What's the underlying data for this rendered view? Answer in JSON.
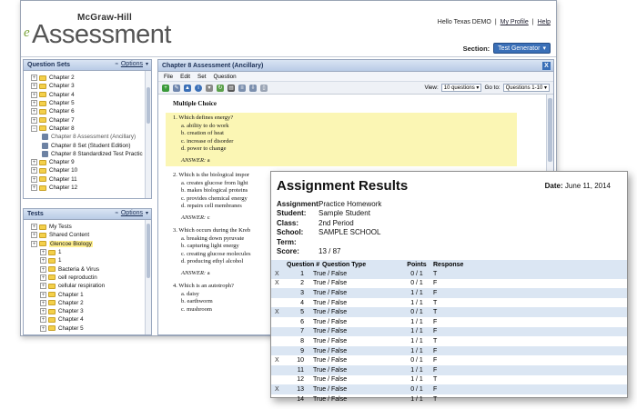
{
  "header": {
    "logo_top": "McGraw-Hill",
    "logo_e": "e",
    "logo_main": "Assessment",
    "greeting": "Hello Texas DEMO",
    "separator": "|",
    "my_profile": "My Profile",
    "help": "Help",
    "section_label": "Section:",
    "section_value": "Test Generator"
  },
  "question_sets": {
    "title": "Question Sets",
    "options": "Options",
    "items": [
      {
        "label": "Chapter 2",
        "kind": "folder"
      },
      {
        "label": "Chapter 3",
        "kind": "folder"
      },
      {
        "label": "Chapter 4",
        "kind": "folder"
      },
      {
        "label": "Chapter 5",
        "kind": "folder"
      },
      {
        "label": "Chapter 6",
        "kind": "folder"
      },
      {
        "label": "Chapter 7",
        "kind": "folder"
      },
      {
        "label": "Chapter 8",
        "kind": "folder",
        "expanded": true
      },
      {
        "label": "Chapter 8 Assessment (Ancillary)",
        "kind": "doc",
        "dim": true
      },
      {
        "label": "Chapter 8 Set (Student Edition)",
        "kind": "doc"
      },
      {
        "label": "Chapter 8 Standardized Test Practic",
        "kind": "doc"
      },
      {
        "label": "Chapter 9",
        "kind": "folder"
      },
      {
        "label": "Chapter 10",
        "kind": "folder"
      },
      {
        "label": "Chapter 11",
        "kind": "folder"
      },
      {
        "label": "Chapter 12",
        "kind": "folder"
      }
    ]
  },
  "tests": {
    "title": "Tests",
    "options": "Options",
    "items": [
      {
        "label": "My Tests",
        "kind": "folder",
        "level": 0
      },
      {
        "label": "Shared Content",
        "kind": "folder",
        "level": 0
      },
      {
        "label": "Glencoe Biology",
        "kind": "folder",
        "level": 0,
        "highlight": true
      },
      {
        "label": "1",
        "kind": "folder",
        "level": 1
      },
      {
        "label": "1",
        "kind": "folder",
        "level": 1
      },
      {
        "label": "Bacteria & Virus",
        "kind": "folder",
        "level": 1
      },
      {
        "label": "cell reproductin",
        "kind": "folder",
        "level": 1
      },
      {
        "label": "cellular respiration",
        "kind": "folder",
        "level": 1
      },
      {
        "label": "Chapter 1",
        "kind": "folder",
        "level": 1
      },
      {
        "label": "Chapter 2",
        "kind": "folder",
        "level": 1
      },
      {
        "label": "Chapter 3",
        "kind": "folder",
        "level": 1
      },
      {
        "label": "Chapter 4",
        "kind": "folder",
        "level": 1
      },
      {
        "label": "Chapter 5",
        "kind": "folder",
        "level": 1
      }
    ]
  },
  "main": {
    "title": "Chapter 8 Assessment (Ancillary)",
    "close": "X",
    "menu": [
      "File",
      "Edit",
      "Set",
      "Question"
    ],
    "view_label": "View:",
    "view_value": "10 questions",
    "goto_label": "Go to:",
    "goto_value": "Questions 1-10",
    "heading": "Multiple Choice",
    "questions": [
      {
        "stem": "1. Which defines energy?",
        "options": [
          "a. ability to do work",
          "b. creation of heat",
          "c. increase of disorder",
          "d. power to change"
        ],
        "answer_label": "ANSWER:",
        "answer": "a",
        "selected": true
      },
      {
        "stem": "2. Which is the biological impor",
        "options": [
          "a. creates glucose from light",
          "b. makes biological proteins",
          "c. provides chemical energy",
          "d. repairs cell membranes"
        ],
        "answer_label": "ANSWER:",
        "answer": "c"
      },
      {
        "stem": "3. Which occurs during the Kreb",
        "options": [
          "a. breaking down pyruvate",
          "b. capturing light energy",
          "c. creating glucose molecules",
          "d. producing ethyl alcohol"
        ],
        "answer_label": "ANSWER:",
        "answer": "a"
      },
      {
        "stem": "4. Which is an autotroph?",
        "options": [
          "a. daisy",
          "b. earthworm",
          "c. mushroom"
        ],
        "answer_label": "",
        "answer": ""
      }
    ]
  },
  "results": {
    "title": "Assignment Results",
    "date_label": "Date:",
    "date": "June 11, 2014",
    "meta": [
      {
        "key": "Assignment:",
        "value": "Practice Homework"
      },
      {
        "key": "Student:",
        "value": "Sample Student"
      },
      {
        "key": "Class:",
        "value": "2nd Period"
      },
      {
        "key": "School:",
        "value": "SAMPLE SCHOOL"
      },
      {
        "key": "Term:",
        "value": ""
      },
      {
        "key": "Score:",
        "value": "13 / 87"
      }
    ],
    "columns": [
      "Question #",
      "Question Type",
      "Points",
      "Response"
    ],
    "rows": [
      {
        "x": "X",
        "q": "1",
        "type": "True / False",
        "points": "0 / 1",
        "resp": "T"
      },
      {
        "x": "X",
        "q": "2",
        "type": "True / False",
        "points": "0 / 1",
        "resp": "F"
      },
      {
        "x": "",
        "q": "3",
        "type": "True / False",
        "points": "1 / 1",
        "resp": "F"
      },
      {
        "x": "",
        "q": "4",
        "type": "True / False",
        "points": "1 / 1",
        "resp": "T"
      },
      {
        "x": "X",
        "q": "5",
        "type": "True / False",
        "points": "0 / 1",
        "resp": "T"
      },
      {
        "x": "",
        "q": "6",
        "type": "True / False",
        "points": "1 / 1",
        "resp": "F"
      },
      {
        "x": "",
        "q": "7",
        "type": "True / False",
        "points": "1 / 1",
        "resp": "F"
      },
      {
        "x": "",
        "q": "8",
        "type": "True / False",
        "points": "1 / 1",
        "resp": "T"
      },
      {
        "x": "",
        "q": "9",
        "type": "True / False",
        "points": "1 / 1",
        "resp": "F"
      },
      {
        "x": "X",
        "q": "10",
        "type": "True / False",
        "points": "0 / 1",
        "resp": "F"
      },
      {
        "x": "",
        "q": "11",
        "type": "True / False",
        "points": "1 / 1",
        "resp": "F"
      },
      {
        "x": "",
        "q": "12",
        "type": "True / False",
        "points": "1 / 1",
        "resp": "T"
      },
      {
        "x": "X",
        "q": "13",
        "type": "True / False",
        "points": "0 / 1",
        "resp": "F"
      },
      {
        "x": "",
        "q": "14",
        "type": "True / False",
        "points": "1 / 1",
        "resp": "T"
      }
    ]
  },
  "colors": {
    "accent": "#3a6fb7",
    "highlight": "#fbf6b4",
    "folder": "#f4d04a",
    "row_band": "#dbe6f3"
  }
}
